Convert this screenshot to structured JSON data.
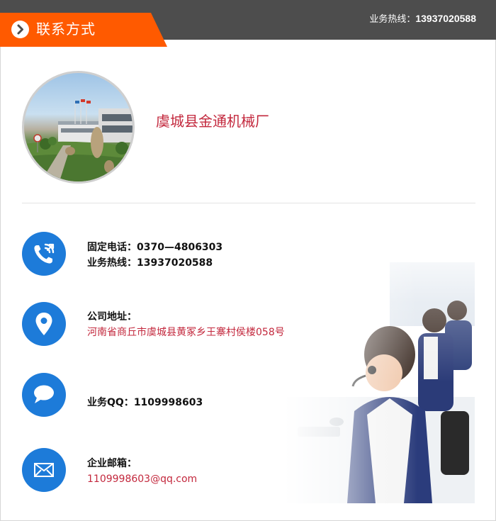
{
  "header": {
    "title": "联系方式",
    "hotline_label": "业务热线：",
    "hotline_number": "13937020588"
  },
  "company": {
    "name": "虞城县金通机械厂"
  },
  "contacts": {
    "phone": {
      "icon": "phone-icon",
      "fixed_label": "固定电话：",
      "fixed_value": "0370—4806303",
      "mobile_label": "业务热线：",
      "mobile_value": "13937020588"
    },
    "address": {
      "icon": "location-pin-icon",
      "label": "公司地址：",
      "value": "河南省商丘市虞城县黄冢乡王寨村侯楼058号"
    },
    "qq": {
      "icon": "chat-bubble-icon",
      "label": "业务QQ：",
      "value": "1109998603"
    },
    "email": {
      "icon": "envelope-icon",
      "label": "企业邮箱：",
      "value": "1109998603@qq.com"
    }
  },
  "colors": {
    "header_bg": "#4d4d4d",
    "tab_accent": "#ff5a00",
    "icon_blue": "#1d7bd9",
    "accent_red": "#c3283d"
  }
}
